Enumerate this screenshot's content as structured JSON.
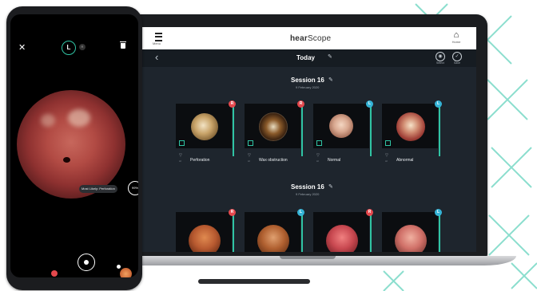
{
  "phone": {
    "lr_selected": "L",
    "lr_other": "R",
    "diagnosis_label": "Most Likely: Perforation",
    "ai_label": "99%"
  },
  "app": {
    "logo_prefix": "hear",
    "logo_suffix": "Scope",
    "menu_label": "Menu",
    "home_label": "Home",
    "day_title": "Today",
    "action_1_label": "Select",
    "action_2_label": "Save",
    "sessions": [
      {
        "title": "Session 16",
        "date": "9 February 2020",
        "cards": [
          {
            "side": "R",
            "label": "Perforation"
          },
          {
            "side": "R",
            "label": "Wax obstruction"
          },
          {
            "side": "L",
            "label": "Normal"
          },
          {
            "side": "L",
            "label": "Abnormal"
          }
        ]
      },
      {
        "title": "Session 16",
        "date": "9 February 2020",
        "cards": [
          {
            "side": "R"
          },
          {
            "side": "L"
          },
          {
            "side": "R"
          },
          {
            "side": "L"
          }
        ]
      }
    ],
    "ai_caption": "AI"
  },
  "colors": {
    "accent": "#30c4a4",
    "badge_red": "#e5484d",
    "badge_blue": "#35b3d6",
    "screen_bg": "#1e252d"
  }
}
